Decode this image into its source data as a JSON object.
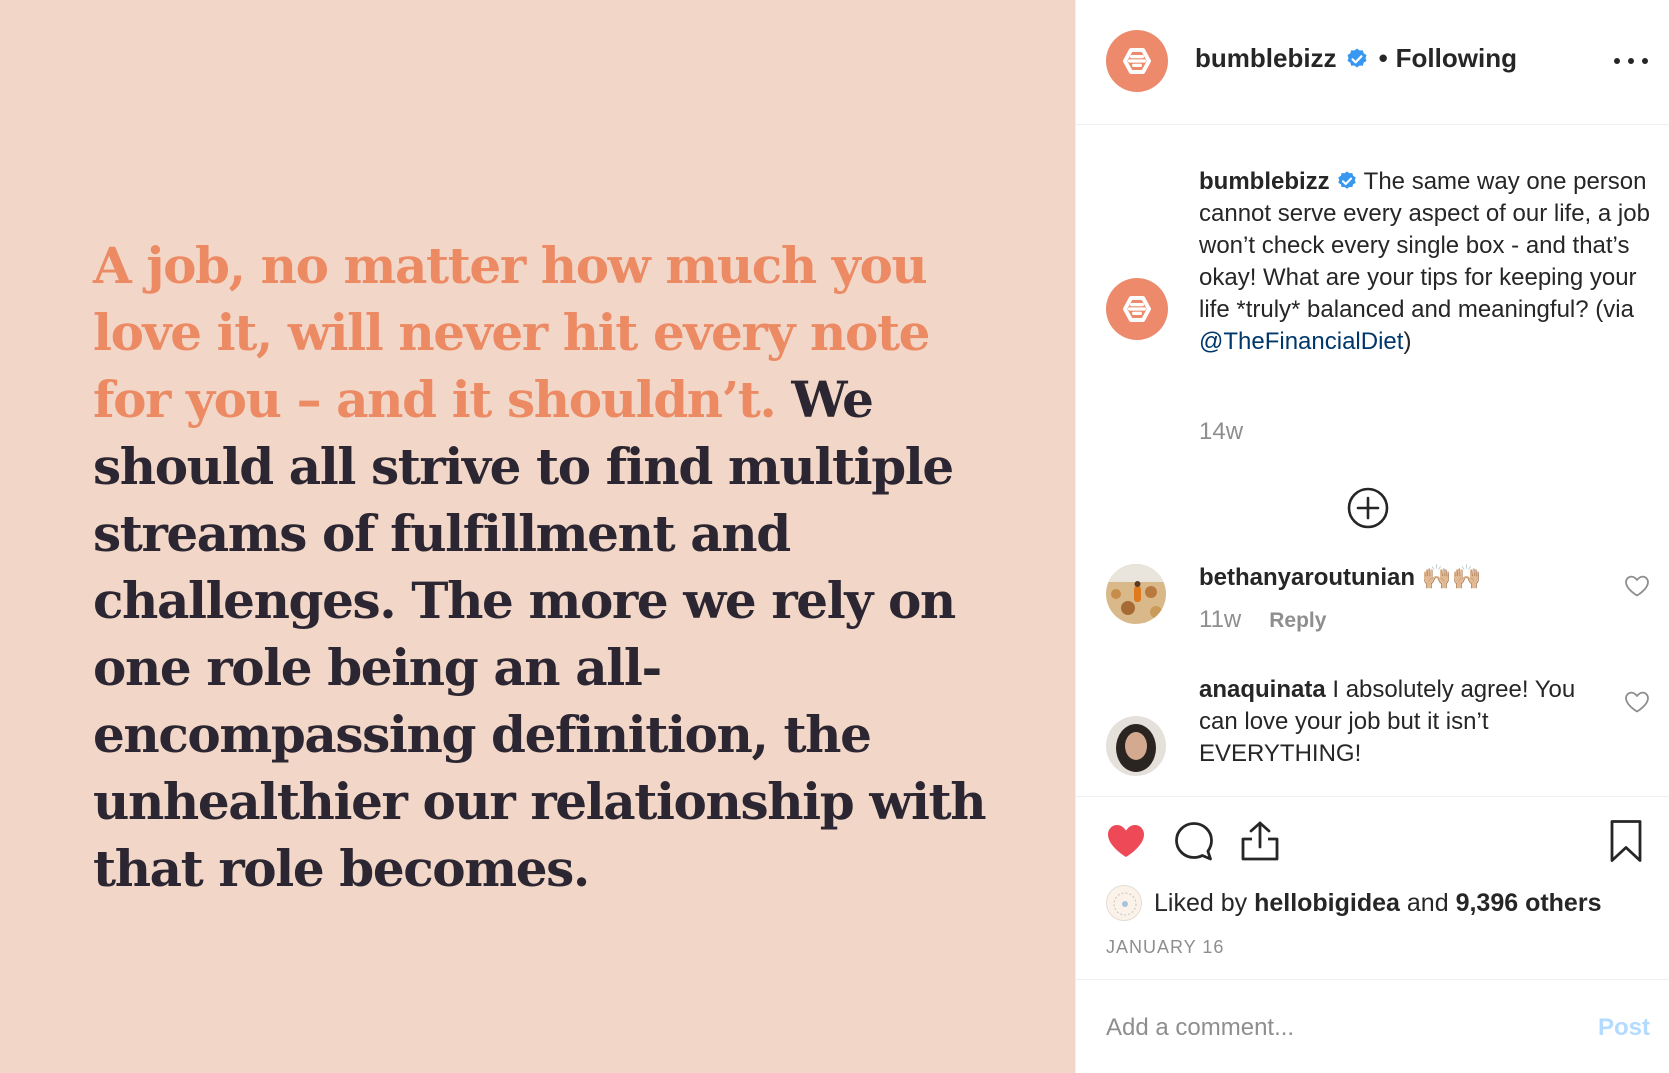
{
  "post": {
    "quote_accent": "A job, no matter how much you love it, will never hit every note for you – and it shouldn’t.",
    "quote_main": " We should all strive to find multiple streams of fulfillment and challenges. The more we rely on one role being an all-encompassing definition, the unhealthier our relationship with that role becomes."
  },
  "header": {
    "username": "bumblebizz",
    "separator": "•",
    "follow_status": "Following",
    "verified_icon": "verified-badge-icon",
    "more_icon": "more-options-icon"
  },
  "caption": {
    "username": "bumblebizz",
    "text_before_mention": "The same way one person cannot serve every aspect of our life, a job won’t check every single box - and that’s okay! What are your tips for keeping your life *truly* balanced and meaningful? (via ",
    "mention": "@TheFinancialDiet",
    "text_after_mention": ")",
    "time": "14w"
  },
  "comments": [
    {
      "username": "bethanyaroutunian",
      "text": "🙌🏼🙌🏼",
      "time": "11w",
      "reply_label": "Reply"
    },
    {
      "username": "anaquinata",
      "text": "I absolutely agree! You can love your job but it isn’t EVERYTHING!"
    }
  ],
  "actions": {
    "liked_by_prefix": "Liked by ",
    "liked_by_user": "hellobigidea",
    "liked_by_middle": " and ",
    "liked_by_count": "9,396 others",
    "date": "JANUARY 16"
  },
  "add_comment": {
    "placeholder": "Add a comment...",
    "post_label": "Post"
  },
  "colors": {
    "image_bg": "#f2d7c9",
    "quote_accent": "#ec8a64",
    "quote_main": "#2b2631",
    "brand": "#ec8a6b",
    "verified": "#3897f0",
    "like_red": "#ed4956",
    "post_disabled": "#b3dbff"
  }
}
